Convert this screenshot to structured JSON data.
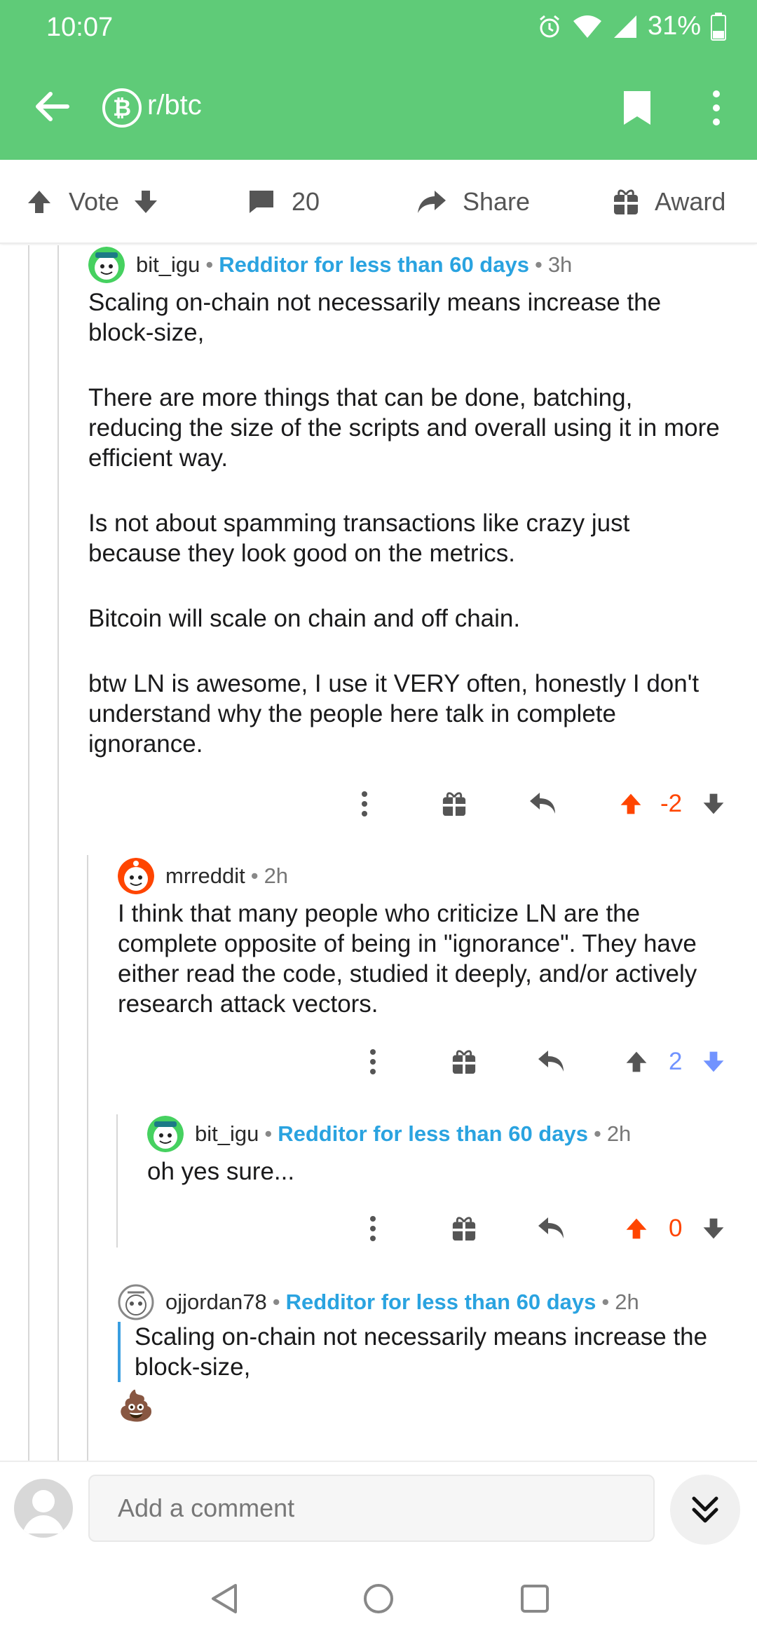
{
  "status_bar": {
    "time": "10:07",
    "battery": "31%"
  },
  "app_bar": {
    "subreddit": "r/btc",
    "subreddit_icon": "bitcoin-icon"
  },
  "action_bar": {
    "vote_label": "Vote",
    "comment_count": "20",
    "share_label": "Share",
    "award_label": "Award"
  },
  "colors": {
    "accent": "#5fcb78",
    "flair": "#2aa3e0",
    "upvote": "#ff4500",
    "downvote": "#7193ff",
    "thread_line": "#d7d7d7"
  },
  "comments": [
    {
      "user": "bit_igu",
      "flair": "Redditor for less than 60 days",
      "age": "3h",
      "paragraphs": [
        "Scaling on-chain not necessarily means increase the block-size,",
        "There are more things that can be done, batching, reducing the size of the scripts and overall using it in more efficient way.",
        "Is not about spamming transactions like crazy just because they look good on the metrics.",
        "Bitcoin will scale on chain and off chain.",
        "btw LN is awesome, I use it VERY often, honestly I don't understand why the people here talk in complete ignorance."
      ],
      "score": "-2",
      "vote_state": "upvoted"
    },
    {
      "user": "mrreddit",
      "age": "2h",
      "paragraphs": [
        "I think that many people who criticize LN are the complete opposite of being in \"ignorance\".  They have either read the code, studied it deeply, and/or actively research attack vectors."
      ],
      "score": "2",
      "vote_state": "downvoted"
    },
    {
      "user": "bit_igu",
      "flair": "Redditor for less than 60 days",
      "age": "2h",
      "paragraphs": [
        "oh yes sure..."
      ],
      "score": "0",
      "vote_state": "upvoted"
    },
    {
      "user": "ojjordan78",
      "flair": "Redditor for less than 60 days",
      "age": "2h",
      "quote": "Scaling on-chain not necessarily means increase the block-size,",
      "emoji": "💩"
    }
  ],
  "composer": {
    "placeholder": "Add a comment"
  }
}
